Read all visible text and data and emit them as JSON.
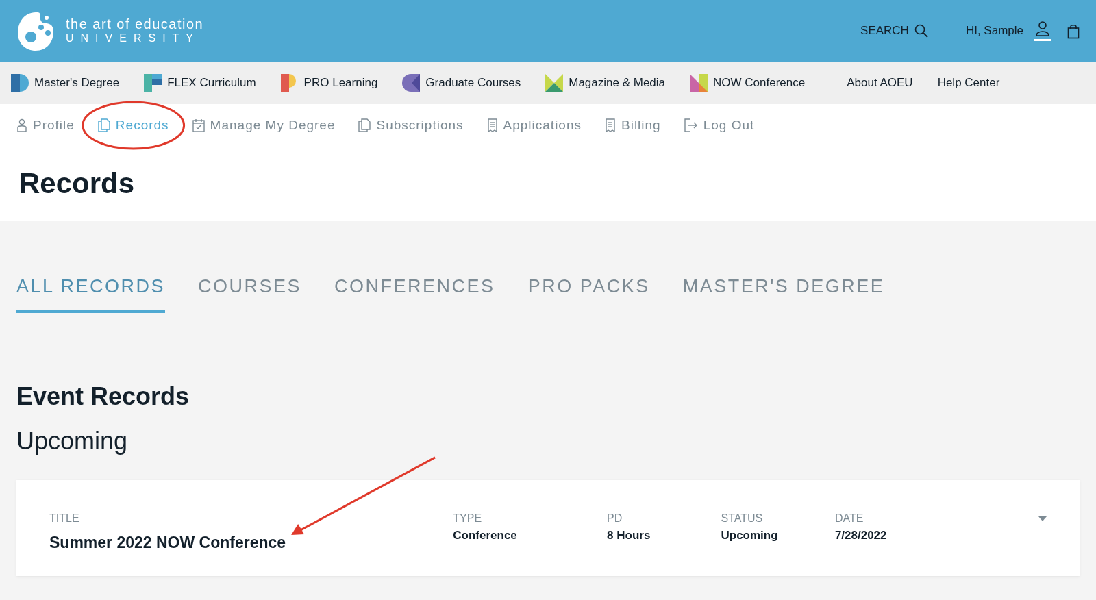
{
  "header": {
    "logo_line1": "the art of education",
    "logo_line2": "UNIVERSITY",
    "search": "SEARCH",
    "greeting": "HI, Sample"
  },
  "products": [
    {
      "label": "Master's Degree",
      "kind": "degree"
    },
    {
      "label": "FLEX Curriculum",
      "kind": "flex"
    },
    {
      "label": "PRO Learning",
      "kind": "pro"
    },
    {
      "label": "Graduate Courses",
      "kind": "courses"
    },
    {
      "label": "Magazine & Media",
      "kind": "media"
    },
    {
      "label": "NOW Conference",
      "kind": "now"
    }
  ],
  "links": [
    "About AOEU",
    "Help Center"
  ],
  "account_nav": [
    {
      "label": "Profile",
      "kind": "person",
      "selected": false
    },
    {
      "label": "Records",
      "kind": "pages",
      "selected": true
    },
    {
      "label": "Manage My Degree",
      "kind": "calendar",
      "selected": false
    },
    {
      "label": "Subscriptions",
      "kind": "pages",
      "selected": false
    },
    {
      "label": "Applications",
      "kind": "receipt",
      "selected": false
    },
    {
      "label": "Billing",
      "kind": "receipt",
      "selected": false
    },
    {
      "label": "Log Out",
      "kind": "logout",
      "selected": false
    }
  ],
  "page_title": "Records",
  "tabs": [
    {
      "label": "ALL RECORDS",
      "selected": true
    },
    {
      "label": "COURSES",
      "selected": false
    },
    {
      "label": "CONFERENCES",
      "selected": false
    },
    {
      "label": "PRO PACKS",
      "selected": false
    },
    {
      "label": "MASTER'S DEGREE",
      "selected": false
    }
  ],
  "section_title": "Event Records",
  "subsection_title": "Upcoming",
  "records": [
    {
      "fields": [
        {
          "label": "TITLE",
          "value": "Summer 2022 NOW Conference"
        },
        {
          "label": "TYPE",
          "value": "Conference"
        },
        {
          "label": "PD",
          "value": "8 Hours"
        },
        {
          "label": "STATUS",
          "value": "Upcoming"
        },
        {
          "label": "DATE",
          "value": "7/28/2022"
        }
      ],
      "expanded": false
    }
  ]
}
